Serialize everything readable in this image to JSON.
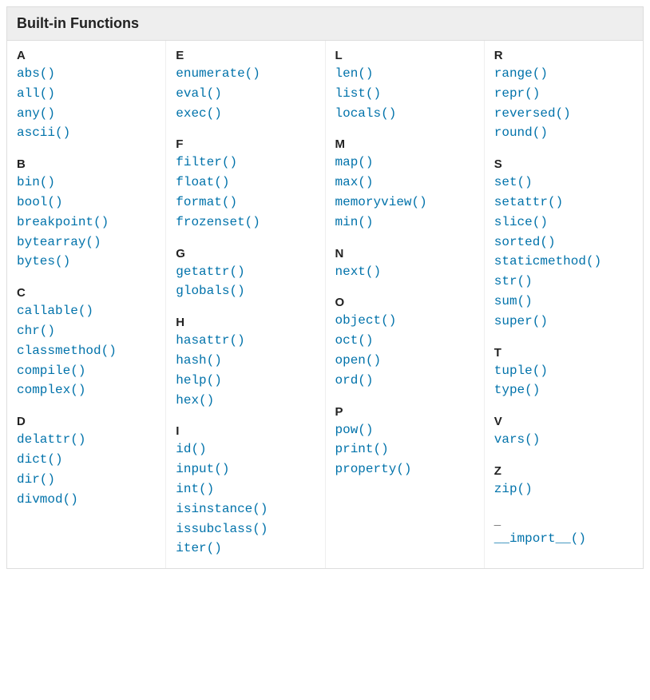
{
  "title": "Built-in Functions",
  "columns": [
    [
      {
        "letter": "A",
        "items": [
          "abs()",
          "all()",
          "any()",
          "ascii()"
        ]
      },
      {
        "letter": "B",
        "items": [
          "bin()",
          "bool()",
          "breakpoint()",
          "bytearray()",
          "bytes()"
        ]
      },
      {
        "letter": "C",
        "items": [
          "callable()",
          "chr()",
          "classmethod()",
          "compile()",
          "complex()"
        ]
      },
      {
        "letter": "D",
        "items": [
          "delattr()",
          "dict()",
          "dir()",
          "divmod()"
        ]
      }
    ],
    [
      {
        "letter": "E",
        "items": [
          "enumerate()",
          "eval()",
          "exec()"
        ]
      },
      {
        "letter": "F",
        "items": [
          "filter()",
          "float()",
          "format()",
          "frozenset()"
        ]
      },
      {
        "letter": "G",
        "items": [
          "getattr()",
          "globals()"
        ]
      },
      {
        "letter": "H",
        "items": [
          "hasattr()",
          "hash()",
          "help()",
          "hex()"
        ]
      },
      {
        "letter": "I",
        "items": [
          "id()",
          "input()",
          "int()",
          "isinstance()",
          "issubclass()",
          "iter()"
        ]
      }
    ],
    [
      {
        "letter": "L",
        "items": [
          "len()",
          "list()",
          "locals()"
        ]
      },
      {
        "letter": "M",
        "items": [
          "map()",
          "max()",
          "memoryview()",
          "min()"
        ]
      },
      {
        "letter": "N",
        "items": [
          "next()"
        ]
      },
      {
        "letter": "O",
        "items": [
          "object()",
          "oct()",
          "open()",
          "ord()"
        ]
      },
      {
        "letter": "P",
        "items": [
          "pow()",
          "print()",
          "property()"
        ]
      }
    ],
    [
      {
        "letter": "R",
        "items": [
          "range()",
          "repr()",
          "reversed()",
          "round()"
        ]
      },
      {
        "letter": "S",
        "items": [
          "set()",
          "setattr()",
          "slice()",
          "sorted()",
          "staticmethod()",
          "str()",
          "sum()",
          "super()"
        ]
      },
      {
        "letter": "T",
        "items": [
          "tuple()",
          "type()"
        ]
      },
      {
        "letter": "V",
        "items": [
          "vars()"
        ]
      },
      {
        "letter": "Z",
        "items": [
          "zip()"
        ]
      },
      {
        "letter": "_",
        "items": [
          "__import__()"
        ]
      }
    ]
  ]
}
